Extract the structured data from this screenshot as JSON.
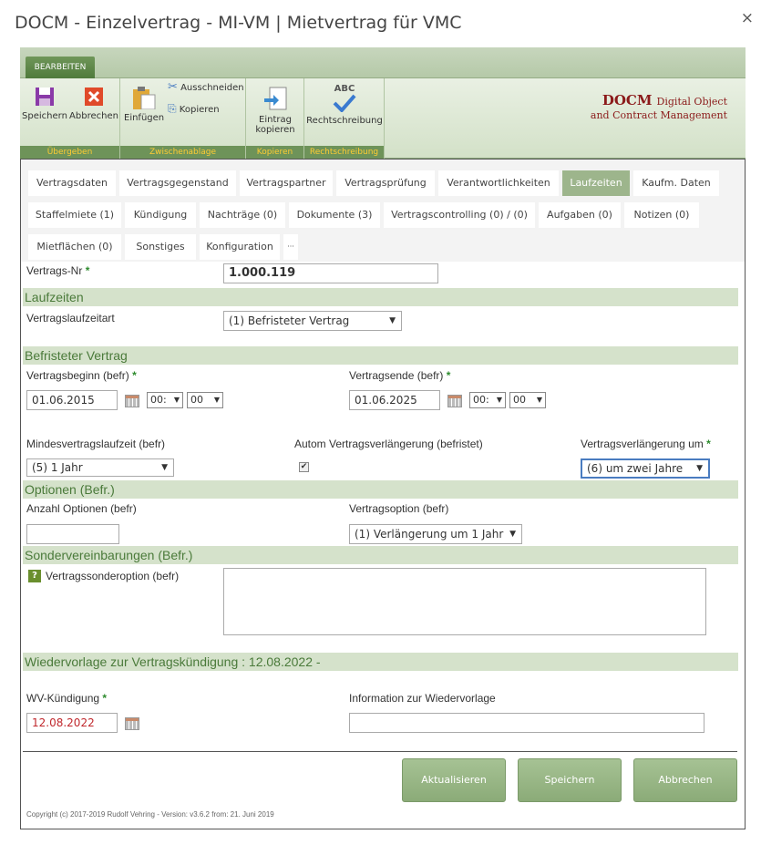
{
  "window": {
    "title": "DOCM - Einzelvertrag - MI-VM | Mietvertrag für VMC",
    "close": "×"
  },
  "ribbon": {
    "tab": "BEARBEITEN",
    "save": "Speichern",
    "cancel": "Abbrechen",
    "paste": "Einfügen",
    "cut": "Ausschneiden",
    "copy": "Kopieren",
    "copy_entry_1": "Eintrag",
    "copy_entry_2": "kopieren",
    "spellcheck": "Rechtschreibung",
    "spell_abc": "ABC",
    "groups": {
      "submit": "Übergeben",
      "clipboard": "Zwischenablage",
      "copy": "Kopieren",
      "spell": "Rechtschreibung"
    },
    "brand_big": "DOCM",
    "brand_line1": "Digital Object",
    "brand_line2": "and Contract Management"
  },
  "tabs": {
    "row1": [
      "Vertragsdaten",
      "Vertragsgegenstand",
      "Vertragspartner",
      "Vertragsprüfung",
      "Verantwortlichkeiten",
      "Laufzeiten",
      "Kaufm. Daten"
    ],
    "row2": [
      "Staffelmiete (1)",
      "Kündigung",
      "Nachträge (0)",
      "Dokumente (3)",
      "Vertragscontrolling (0) / (0)",
      "Aufgaben (0)",
      "Notizen (0)"
    ],
    "row3": [
      "Mietflächen (0)",
      "Sonstiges",
      "Konfiguration",
      "···"
    ]
  },
  "form": {
    "contract_no_label": "Vertrags-Nr",
    "contract_no": "1.000.119",
    "req": "*",
    "sec_terms": "Laufzeiten",
    "term_type_label": "Vertragslaufzeitart",
    "term_type": "(1) Befristeter Vertrag",
    "sec_fixed": "Befristeter Vertrag",
    "start_label": "Vertragsbeginn (befr)",
    "start_date": "01.06.2015",
    "end_label": "Vertragsende (befr)",
    "end_date": "01.06.2025",
    "hour": "00:",
    "minute": "00",
    "min_term_label": "Mindesvertragslaufzeit (befr)",
    "min_term": "(5) 1 Jahr",
    "auto_ext_label": "Autom Vertragsverlängerung (befristet)",
    "auto_ext_check": "✔",
    "ext_by_label": "Vertragsverlängerung um",
    "ext_by": "(6) um zwei Jahre",
    "sec_options": "Optionen (Befr.)",
    "options_count_label": "Anzahl Optionen (befr)",
    "options_count": "",
    "option_label": "Vertragsoption (befr)",
    "option": "(1) Verlängerung um 1 Jahr",
    "sec_special": "Sondervereinbarungen (Befr.)",
    "help": "?",
    "special_option_label": "Vertragssonderoption (befr)",
    "sec_resubmit": "Wiedervorlage zur Vertragskündigung : 12.08.2022 -",
    "wv_label": "WV-Kündigung",
    "wv_date": "12.08.2022",
    "wv_info_label": "Information zur Wiedervorlage",
    "wv_info": ""
  },
  "buttons": {
    "update": "Aktualisieren",
    "save": "Speichern",
    "cancel": "Abbrechen"
  },
  "footer": {
    "copyright": "Copyright (c) 2017-2019 Rudolf Vehring - Version: v3.6.2 from: 21. Juni 2019"
  }
}
